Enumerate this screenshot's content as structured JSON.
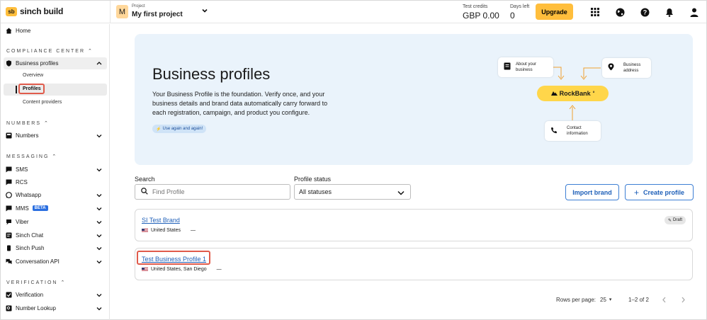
{
  "brand": {
    "logo_text": "sinch build",
    "logo_mark": "sb"
  },
  "topbar": {
    "project_label": "Project",
    "project_avatar": "M",
    "project_name": "My first project",
    "credits_label": "Test credits",
    "credits_value": "GBP 0.00",
    "days_label": "Days left",
    "days_value": "0",
    "upgrade_label": "Upgrade",
    "icons": [
      "apps-grid-icon",
      "globe-icon",
      "help-icon",
      "bell-icon",
      "user-icon"
    ]
  },
  "sidebar": {
    "home": "Home",
    "compliance_section": "COMPLIANCE CENTER",
    "business_profiles": "Business profiles",
    "sub_overview": "Overview",
    "sub_profiles": "Profiles",
    "sub_content_providers": "Content providers",
    "numbers_section": "NUMBERS",
    "numbers": "Numbers",
    "messaging_section": "MESSAGING",
    "messaging_items": [
      "SMS",
      "RCS",
      "Whatsapp",
      "MMS",
      "Viber",
      "Sinch Chat",
      "Sinch Push",
      "Conversation API"
    ],
    "mms_badge": "BETA",
    "verification_section": "VERIFICATION",
    "verification_items": [
      "Verification",
      "Number Lookup"
    ]
  },
  "hero": {
    "title": "Business profiles",
    "description": "Your Business Profile is the foundation. Verify once, and your business details and brand data automatically carry forward to each registration, campaign, and product you configure.",
    "pill": "Use again and again!",
    "card_about": "About your business",
    "card_address": "Business address",
    "card_contact": "Contact information",
    "brand_name": "RockBank"
  },
  "filters": {
    "search_label": "Search",
    "search_placeholder": "Find Profile",
    "status_label": "Profile status",
    "status_value": "All statuses",
    "import_label": "Import brand",
    "create_label": "Create profile"
  },
  "profiles": [
    {
      "name": "SI Test Brand",
      "location": "United States",
      "extra": "—",
      "badge": "Draft"
    },
    {
      "name": "Test Business Profile 1",
      "location": "United States, San Diego",
      "extra": "—"
    }
  ],
  "pagination": {
    "rows_label": "Rows per page:",
    "rows_value": "25",
    "range": "1–2 of 2"
  }
}
